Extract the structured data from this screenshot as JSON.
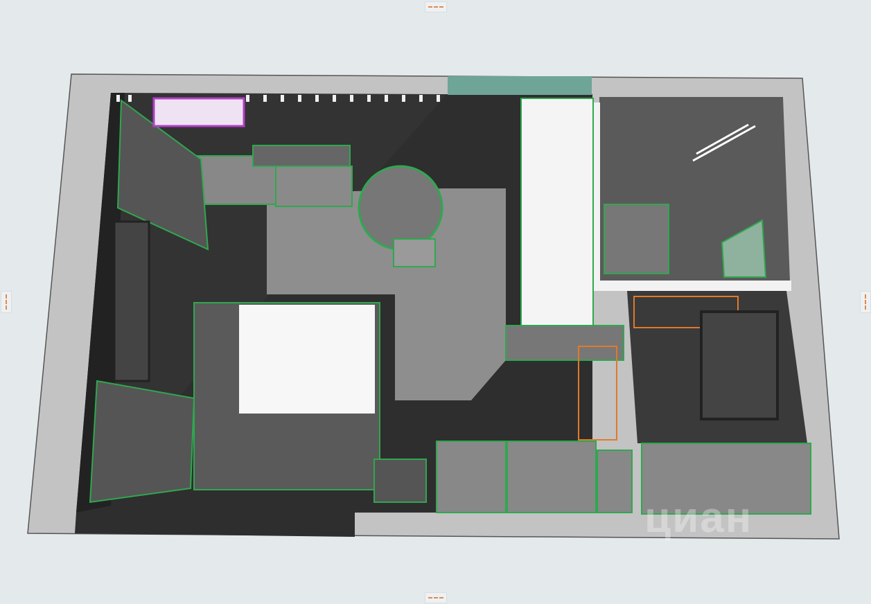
{
  "viewer": {
    "resize_handles": [
      "top",
      "bottom",
      "left",
      "right"
    ]
  },
  "watermark": {
    "brand": "циан"
  },
  "colors": {
    "background": "#e4e9ec",
    "slab": "#c3c3c3",
    "floor_dark": "#3a3a3a",
    "furniture_outline": "#2fa84f",
    "door_outline": "#e07a2a",
    "ac_unit": "#b23fc8",
    "tile_floor": "#8e8e8e"
  }
}
